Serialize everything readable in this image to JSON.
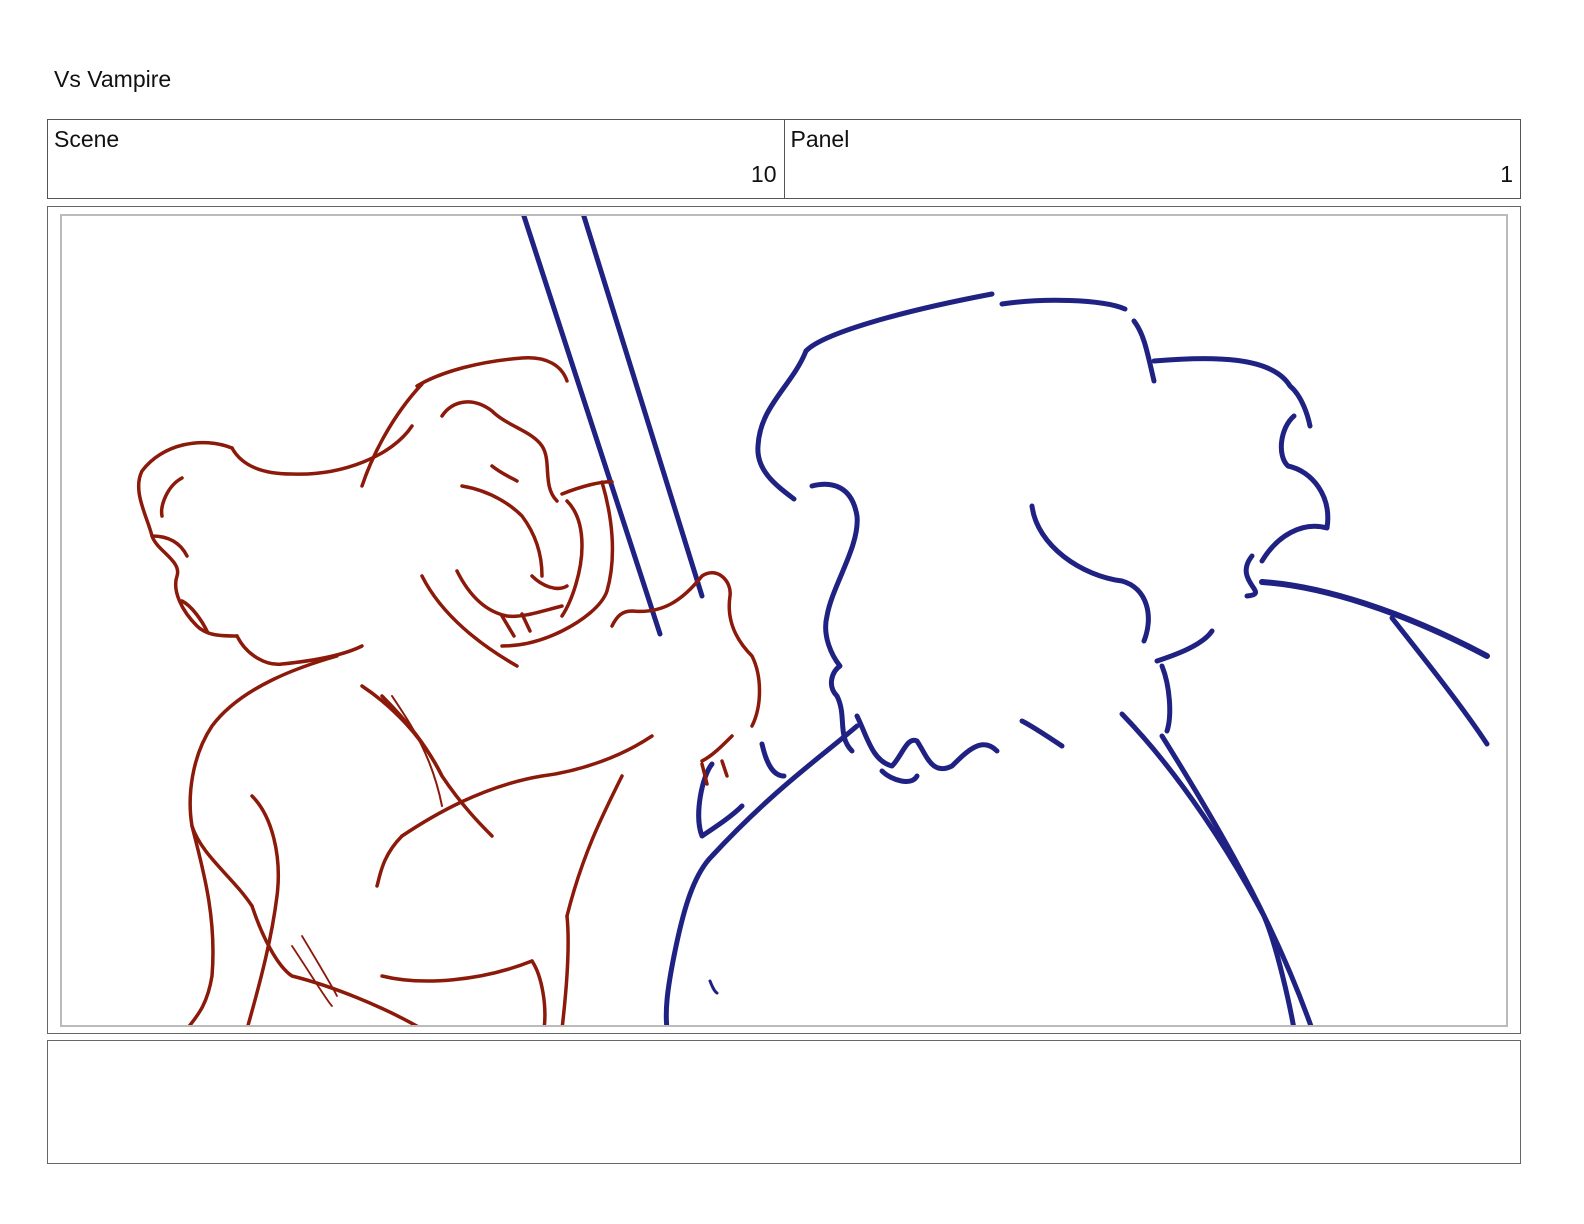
{
  "document": {
    "title": "Vs Vampire"
  },
  "header": {
    "scene_label": "Scene",
    "scene_value": "10",
    "panel_label": "Panel",
    "panel_value": "1"
  },
  "panel": {
    "drawing": "storyboard-sketch",
    "colors": {
      "vampire_stroke": "#8b1a0a",
      "hero_stroke": "#1f2282",
      "frame_border": "#bbbbbb"
    }
  },
  "notes": {
    "text": ""
  }
}
